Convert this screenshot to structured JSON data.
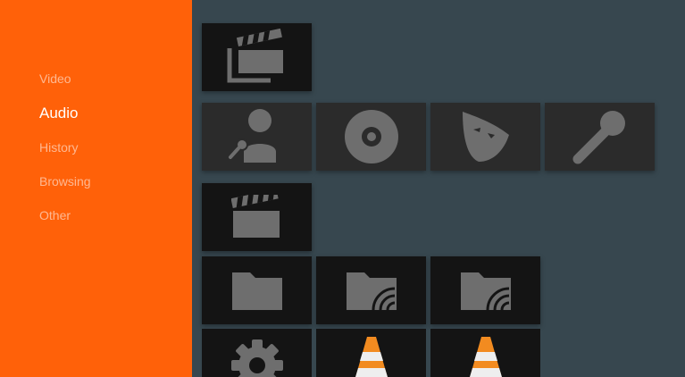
{
  "sidebar": {
    "items": [
      {
        "label": "Video",
        "active": false
      },
      {
        "label": "Audio",
        "active": true
      },
      {
        "label": "History",
        "active": false
      },
      {
        "label": "Browsing",
        "active": false
      },
      {
        "label": "Other",
        "active": false
      }
    ]
  },
  "colors": {
    "sidebar_bg": "#ff6109",
    "content_bg": "#37474f",
    "card_bg": "#2b2b2b",
    "card_dark_bg": "#141414",
    "icon": "#6e6e6e",
    "cone_orange": "#f28b20"
  },
  "grid": {
    "video_row": [
      "videos-stack-icon"
    ],
    "audio_row": [
      "artist-icon",
      "album-disc-icon",
      "genre-mask-icon",
      "microphone-icon"
    ],
    "history_row": [
      "clapperboard-icon"
    ],
    "browsing_row": [
      "folder-icon",
      "network-folder-icon",
      "network-folder-icon"
    ],
    "other_row": [
      "gear-icon",
      "vlc-cone-icon",
      "vlc-cone-icon"
    ]
  }
}
